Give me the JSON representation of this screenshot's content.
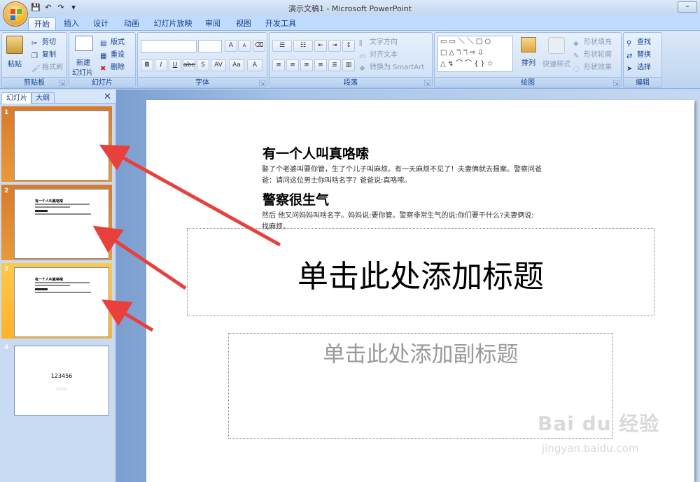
{
  "window": {
    "title": "演示文稿1 - Microsoft PowerPoint",
    "control": "–"
  },
  "qat": {
    "save": "💾",
    "undo": "↶",
    "redo": "↷",
    "more": "▾"
  },
  "tabs": [
    "开始",
    "插入",
    "设计",
    "动画",
    "幻灯片放映",
    "审阅",
    "视图",
    "开发工具"
  ],
  "ribbon": {
    "clipboard": {
      "label": "剪贴板",
      "paste": "粘贴",
      "cut": "剪切",
      "copy": "复制",
      "format_painter": "格式刷"
    },
    "slides": {
      "label": "幻灯片",
      "new_slide": "新建",
      "new_slide2": "幻灯片",
      "layout": "版式",
      "reset": "重设",
      "delete": "删除"
    },
    "font": {
      "label": "字体",
      "buttons": [
        "B",
        "I",
        "U",
        "abe",
        "S",
        "AV",
        "Aa",
        "A"
      ],
      "grow": "A",
      "shrink": "A"
    },
    "paragraph": {
      "label": "段落",
      "text_direction": "文字方向",
      "align_text": "对齐文本",
      "smartart": "转换为 SmartArt"
    },
    "drawing": {
      "label": "绘图",
      "arrange": "排列",
      "quick_styles": "快速样式",
      "fill": "形状填充",
      "outline": "形状轮廓",
      "effects": "形状效果"
    },
    "editing": {
      "label": "编辑",
      "find": "查找",
      "replace": "替换",
      "select": "选择"
    }
  },
  "panel": {
    "tabs": [
      "幻灯片",
      "大纲"
    ],
    "close": "✕"
  },
  "thumbnails": [
    {
      "num": "1"
    },
    {
      "num": "2",
      "title": "有一个人叫真咯嗦"
    },
    {
      "num": "3",
      "title": "有一个人叫真咯嗦"
    },
    {
      "num": "4",
      "text": "123456",
      "sub": "□□□□"
    }
  ],
  "slide": {
    "heading1": "有一个人叫真咯嗦",
    "para1_line1": "娶了个老婆叫要你管，生了个儿子叫麻烦。有一天麻烦不见了！夫妻俩就去报案。警察问爸",
    "para1_line2": "爸：请问这位男士你叫啥名字？爸爸说:真咯嗦。",
    "heading2": "警察很生气",
    "para2_line1": "然后 他又问妈妈叫啥名字。妈妈说:要你管。警察非常生气的说:你们要干什么?夫妻俩说:",
    "para2_line2": "找麻烦。",
    "title_placeholder": "单击此处添加标题",
    "subtitle_placeholder": "单击此处添加副标题"
  },
  "watermark": {
    "brand": "Bai du 经验",
    "url": "jingyan.baidu.com"
  },
  "colors": {
    "arrow": "#e8403c",
    "selected_slot": "#e08a32"
  }
}
